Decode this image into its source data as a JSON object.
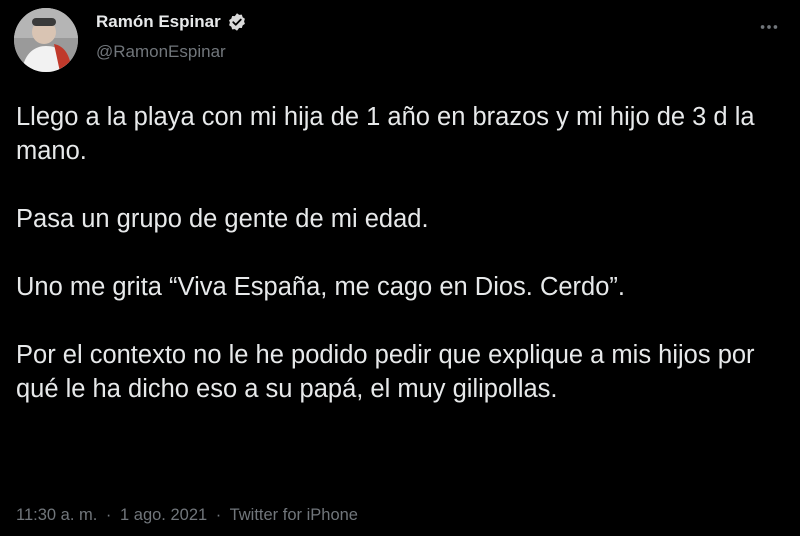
{
  "colors": {
    "background": "#000000",
    "text_primary": "#e7e9ea",
    "text_secondary": "#71767b",
    "verified_badge": "#d9d9d9"
  },
  "author": {
    "display_name": "Ramón Espinar",
    "handle": "@RamonEspinar",
    "verified_icon": "verified-badge-icon",
    "avatar_icon": "avatar-photo"
  },
  "header": {
    "more_icon": "more-options-icon"
  },
  "tweet": {
    "paragraphs": [
      "Llego a la playa con mi hija de 1 año en brazos y mi hijo de 3 d la mano.",
      "Pasa un grupo de gente de mi edad.",
      "Uno me grita “Viva España, me cago en Dios. Cerdo”.",
      "Por el contexto no le he podido pedir que explique a mis hijos por qué le ha dicho eso a su papá, el muy gilipollas."
    ]
  },
  "meta": {
    "time": "11:30 a. m.",
    "separator": "·",
    "date": "1 ago. 2021",
    "source": "Twitter for iPhone"
  }
}
